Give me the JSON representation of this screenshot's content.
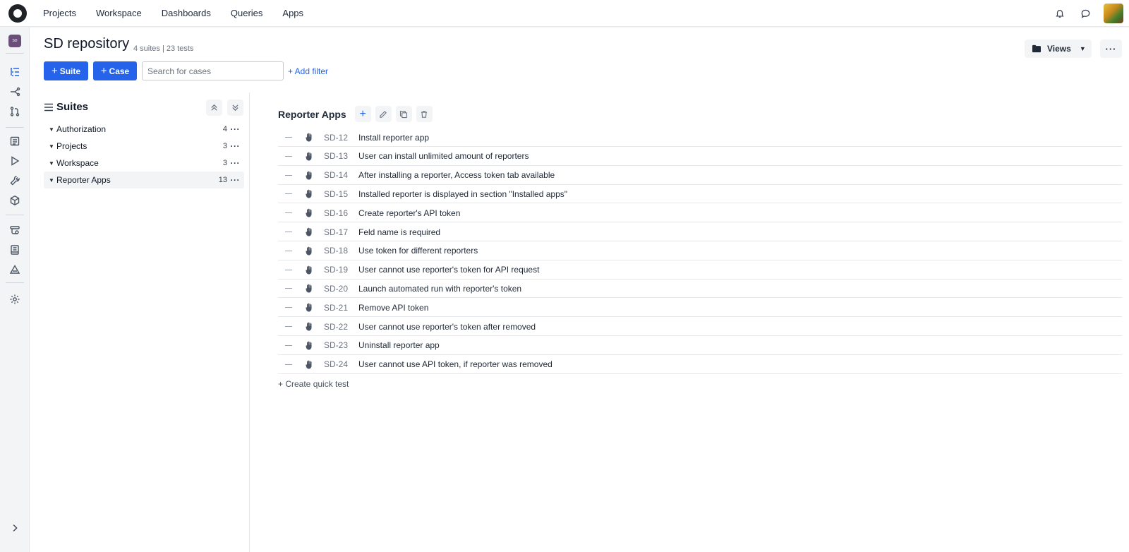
{
  "topnav": {
    "items": [
      "Projects",
      "Workspace",
      "Dashboards",
      "Queries",
      "Apps"
    ],
    "icons": [
      "bell-icon",
      "chat-icon"
    ]
  },
  "rail": {
    "project_badge": "SD"
  },
  "header": {
    "title": "SD repository",
    "meta": "4 suites | 23 tests",
    "views_label": "Views",
    "more_label": "···"
  },
  "toolbar": {
    "suite_btn": "Suite",
    "case_btn": "Case",
    "search_placeholder": "Search for cases",
    "search_value": "",
    "add_filter": "+ Add filter"
  },
  "suites": {
    "title": "Suites",
    "items": [
      {
        "name": "Authorization",
        "count": "4"
      },
      {
        "name": "Projects",
        "count": "3"
      },
      {
        "name": "Workspace",
        "count": "3"
      },
      {
        "name": "Reporter Apps",
        "count": "13"
      }
    ],
    "dots": "···"
  },
  "cases": {
    "suite_title": "Reporter Apps",
    "rows": [
      {
        "id": "SD-12",
        "title": "Install reporter app"
      },
      {
        "id": "SD-13",
        "title": "User can install unlimited amount of reporters"
      },
      {
        "id": "SD-14",
        "title": "After installing a reporter, Access token tab available"
      },
      {
        "id": "SD-15",
        "title": "Installed reporter is displayed in section \"Installed apps\""
      },
      {
        "id": "SD-16",
        "title": "Create reporter's API token"
      },
      {
        "id": "SD-17",
        "title": "Feld name is required"
      },
      {
        "id": "SD-18",
        "title": "Use token for different reporters"
      },
      {
        "id": "SD-19",
        "title": "User cannot use reporter's token for API request"
      },
      {
        "id": "SD-20",
        "title": "Launch automated run with reporter's token"
      },
      {
        "id": "SD-21",
        "title": "Remove API token"
      },
      {
        "id": "SD-22",
        "title": "User cannot use reporter's token after removed"
      },
      {
        "id": "SD-23",
        "title": "Uninstall reporter app"
      },
      {
        "id": "SD-24",
        "title": "User cannot use API token, if reporter was removed"
      }
    ],
    "quick_test": "+ Create quick test"
  },
  "colors": {
    "accent": "#2563eb",
    "rail_bg": "#f3f4f6",
    "project_badge": "#6b4f7a"
  }
}
